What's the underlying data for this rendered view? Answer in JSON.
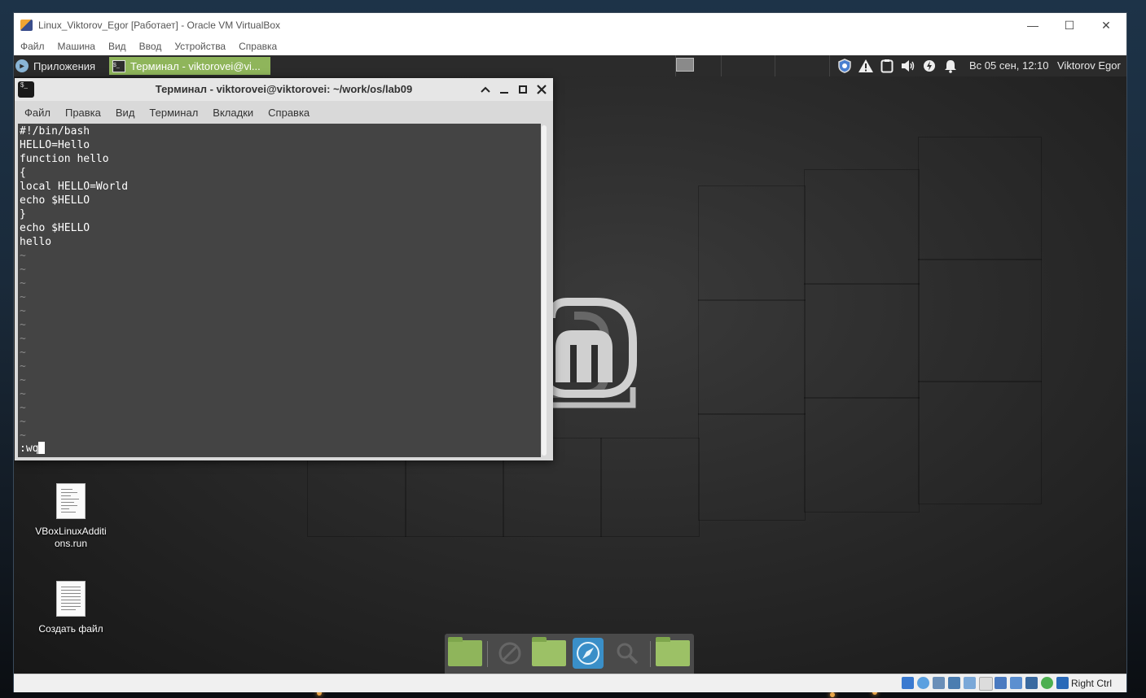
{
  "vbox": {
    "title": "Linux_Viktorov_Egor [Работает] - Oracle VM VirtualBox",
    "controls": {
      "minimize": "—",
      "maximize": "☐",
      "close": "✕"
    },
    "menu": [
      "Файл",
      "Машина",
      "Вид",
      "Ввод",
      "Устройства",
      "Справка"
    ],
    "host_key": "Right Ctrl"
  },
  "panel": {
    "apps_label": "Приложения",
    "task_label": "Терминал - viktorovei@vi...",
    "clock": "Вс 05 сен, 12:10",
    "user": "Viktorov Egor"
  },
  "terminal": {
    "title": "Терминал - viktorovei@viktorovei: ~/work/os/lab09",
    "menu": [
      "Файл",
      "Правка",
      "Вид",
      "Терминал",
      "Вкладки",
      "Справка"
    ],
    "lines": [
      "#!/bin/bash",
      "HELLO=Hello",
      "function hello",
      "{",
      "local HELLO=World",
      "echo $HELLO",
      "}",
      "echo $HELLO",
      "hello"
    ],
    "tilde_count": 14,
    "tilde": "~",
    "command": ":wq"
  },
  "desktop_icons": [
    {
      "label_line1": "VBoxLinuxAdditi",
      "label_line2": "ons.run"
    },
    {
      "label_line1": "Создать файл",
      "label_line2": ""
    }
  ],
  "colors": {
    "accent_green": "#8fb55b",
    "panel_bg": "#2b2b2b",
    "terminal_bg": "#444444"
  }
}
